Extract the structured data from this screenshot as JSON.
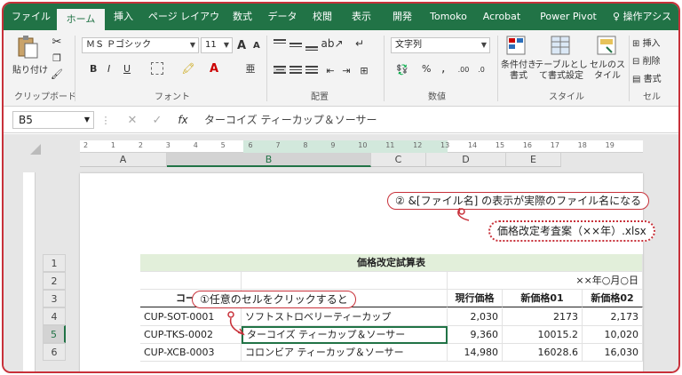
{
  "ribbon_tabs": [
    "ファイル",
    "ホーム",
    "挿入",
    "ページ レイアウト",
    "数式",
    "データ",
    "校閲",
    "表示",
    "開発",
    "Tomoko",
    "Acrobat",
    "Power Pivot"
  ],
  "active_tab": "ホーム",
  "tell_me": "操作アシスト",
  "groups": {
    "clipboard": {
      "label": "クリップボード",
      "paste": "貼り付け"
    },
    "font": {
      "label": "フォント",
      "font_name": "ＭＳ Ｐゴシック",
      "font_size": "11",
      "bold": "B",
      "italic": "I",
      "underline": "U",
      "increase": "A",
      "decrease": "A"
    },
    "alignment": {
      "label": "配置"
    },
    "number": {
      "label": "数値",
      "format": "文字列",
      "percent": "%",
      "comma": ","
    },
    "styles": {
      "label": "スタイル",
      "conditional": "条件付き書式",
      "as_table": "テーブルとして書式設定",
      "cell_styles": "セルのスタイル"
    },
    "cells": {
      "label": "セル",
      "insert": "挿入",
      "delete": "削除",
      "format": "書式"
    }
  },
  "formula_bar": {
    "name_box": "B5",
    "formula": "ターコイズ ティーカップ＆ソーサー",
    "fx": "fx"
  },
  "columns": [
    "A",
    "B",
    "C",
    "D",
    "E"
  ],
  "selected_column": "B",
  "ruler_marks": [
    "2",
    "1",
    "2",
    "3",
    "4",
    "5",
    "6",
    "7",
    "8",
    "9",
    "10",
    "11",
    "12",
    "13",
    "14",
    "15",
    "16",
    "17",
    "18",
    "19"
  ],
  "rows": [
    "1",
    "2",
    "3",
    "4",
    "5",
    "6"
  ],
  "selected_row": "5",
  "header_text": "価格改定考査案（××年）.xlsx",
  "callouts": {
    "filename_note": "② &[ファイル名] の表示が実際のファイル名になる",
    "click_note": "①任意のセルをクリックすると"
  },
  "sheet": {
    "title": "価格改定試算表",
    "date": "××年○月○日",
    "headers": [
      "コード",
      "品名",
      "現行価格",
      "新価格01",
      "新価格02"
    ],
    "rows": [
      [
        "CUP-SOT-0001",
        "ソフトストロベリーティーカップ",
        "2,030",
        "2173",
        "2,173"
      ],
      [
        "CUP-TKS-0002",
        "ターコイズ ティーカップ＆ソーサー",
        "9,360",
        "10015.2",
        "10,020"
      ],
      [
        "CUP-XCB-0003",
        "コロンビア ティーカップ＆ソーサー",
        "14,980",
        "16028.6",
        "16,030"
      ]
    ]
  },
  "colors": {
    "excel_green": "#217346",
    "title_fill": "#e2efda",
    "callout_red": "#c8313a"
  }
}
